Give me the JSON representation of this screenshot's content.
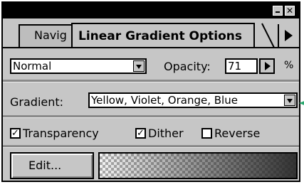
{
  "palette": {
    "tabs": [
      {
        "label": "Navig",
        "active": false
      },
      {
        "label": "Linear Gradient Options",
        "active": true
      }
    ]
  },
  "blend": {
    "mode": "Normal"
  },
  "opacity": {
    "label": "Opacity:",
    "value": "71",
    "unit": "%"
  },
  "gradient": {
    "label": "Gradient:",
    "selected": "Yellow, Violet, Orange, Blue"
  },
  "options": {
    "transparency": {
      "label": "Transparency",
      "checked": true,
      "mark": "✓"
    },
    "dither": {
      "label": "Dither",
      "checked": true,
      "mark": "✓"
    },
    "reverse": {
      "label": "Reverse",
      "checked": false,
      "mark": ""
    }
  },
  "edit_button": {
    "label": "Edit..."
  },
  "colors": {
    "frame": "#000000",
    "panel": "#c6c6c6",
    "accent_marker": "#2aa86e"
  }
}
